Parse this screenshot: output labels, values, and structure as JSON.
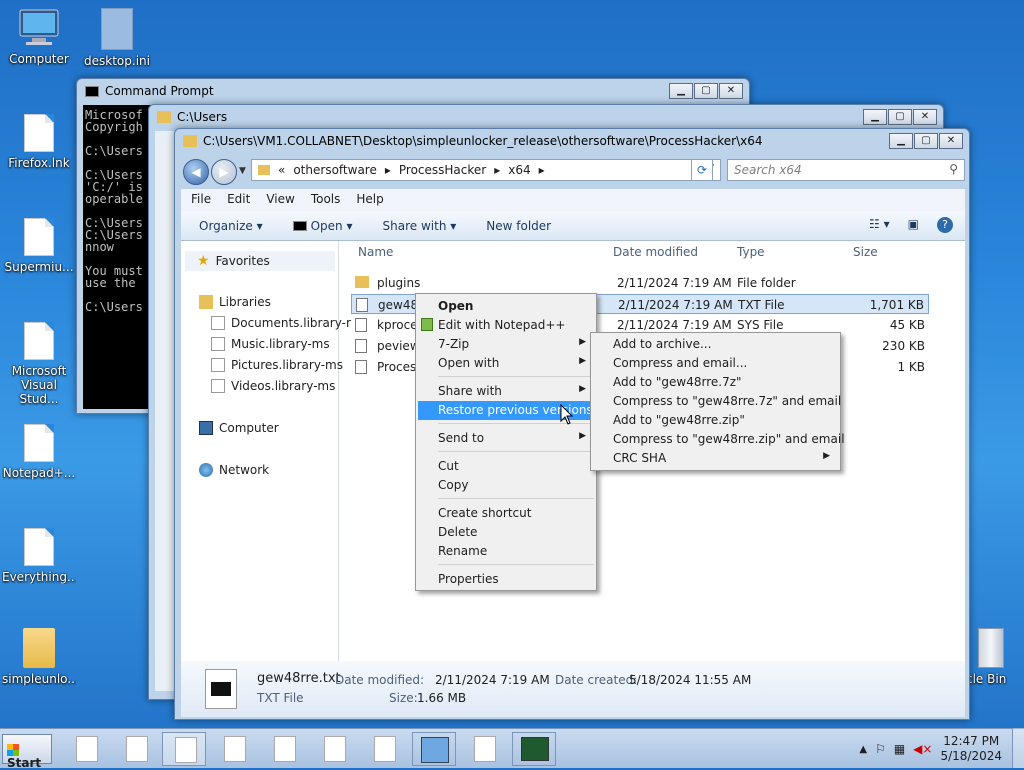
{
  "desktop": {
    "icons": {
      "computer": "Computer",
      "desktop_ini": "desktop.ini",
      "firefox": "Firefox.lnk",
      "supermium": "Supermiu...",
      "visual_studio": "Microsoft Visual Stud...",
      "notepad": "Notepad+...",
      "everything": "Everything...",
      "simpleunlocker": "simpleunlo...",
      "recycle_bin": "cle Bin"
    }
  },
  "cmd_window": {
    "title": "Command Prompt",
    "lines": [
      "Microsof",
      "Copyrigh",
      "",
      "C:\\Users",
      "",
      "C:\\Users",
      "'C:/' is",
      "operable",
      "",
      "C:\\Users",
      "C:\\Users",
      "nnow",
      "",
      "You must",
      "use the",
      "",
      "C:\\Users"
    ]
  },
  "users_window": {
    "title": "C:\\Users"
  },
  "explorer": {
    "title": "C:\\Users\\VM1.COLLABNET\\Desktop\\simpleunlocker_release\\othersoftware\\ProcessHacker\\x64",
    "breadcrumb": [
      "«",
      "othersoftware",
      "ProcessHacker",
      "x64"
    ],
    "search_placeholder": "Search x64",
    "menu": [
      "File",
      "Edit",
      "View",
      "Tools",
      "Help"
    ],
    "commands": {
      "organize": "Organize",
      "open": "Open",
      "share_with": "Share with",
      "new_folder": "New folder"
    },
    "nav": {
      "favorites": "Favorites",
      "libraries": "Libraries",
      "lib_items": [
        "Documents.library-r",
        "Music.library-ms",
        "Pictures.library-ms",
        "Videos.library-ms"
      ],
      "computer": "Computer",
      "network": "Network"
    },
    "columns": {
      "name": "Name",
      "date": "Date modified",
      "type": "Type",
      "size": "Size"
    },
    "rows": [
      {
        "name": "plugins",
        "date": "2/11/2024 7:19 AM",
        "type": "File folder",
        "size": ""
      },
      {
        "name": "gew48r",
        "date": "2/11/2024 7:19 AM",
        "type": "TXT File",
        "size": "1,701 KB"
      },
      {
        "name": "kproce",
        "date": "2/11/2024 7:19 AM",
        "type": "SYS File",
        "size": "45 KB"
      },
      {
        "name": "peview",
        "date": "",
        "type": "",
        "size": "230 KB"
      },
      {
        "name": "Process",
        "date": "",
        "type": "",
        "size": "1 KB"
      }
    ],
    "details": {
      "filename": "gew48rre.txt",
      "filetype": "TXT File",
      "date_modified_label": "Date modified:",
      "date_modified": "2/11/2024 7:19 AM",
      "size_label": "Size:",
      "size": "1.66 MB",
      "date_created_label": "Date created:",
      "date_created": "5/18/2024 11:55 AM"
    }
  },
  "context_menu": {
    "open": "Open",
    "edit_notepad": "Edit with Notepad++",
    "seven_zip": "7-Zip",
    "open_with": "Open with",
    "share_with": "Share with",
    "restore": "Restore previous versions",
    "send_to": "Send to",
    "cut": "Cut",
    "copy": "Copy",
    "create_shortcut": "Create shortcut",
    "delete": "Delete",
    "rename": "Rename",
    "properties": "Properties"
  },
  "zip_menu": {
    "items": [
      "Add to archive...",
      "Compress and email...",
      "Add to \"gew48rre.7z\"",
      "Compress to \"gew48rre.7z\" and email",
      "Add to \"gew48rre.zip\"",
      "Compress to \"gew48rre.zip\" and email",
      "CRC SHA"
    ]
  },
  "taskbar": {
    "start": "Start",
    "time": "12:47 PM",
    "date": "5/18/2024"
  },
  "colors": {
    "highlight": "#3399ff",
    "selection": "#d5e6f9",
    "desktop": "#2a86da"
  }
}
